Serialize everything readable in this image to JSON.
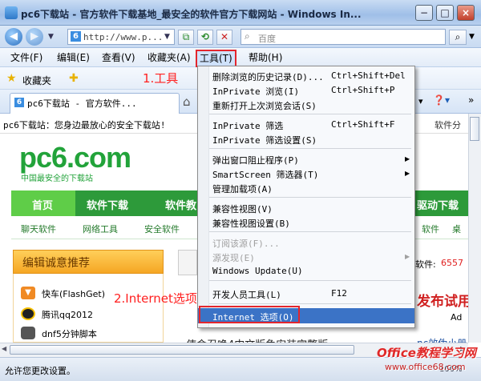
{
  "window": {
    "title": "pc6下载站 - 官方软件下载基地_最安全的软件官方下载网站 - Windows In...",
    "minimize": "−",
    "maximize": "□",
    "close": "×"
  },
  "address_bar": {
    "back": "◀",
    "forward": "▶",
    "url": "http://www.p...",
    "search_placeholder": "百度"
  },
  "menu_bar": {
    "items": [
      "文件(F)",
      "编辑(E)",
      "查看(V)",
      "收藏夹(A)",
      "工具(T)",
      "帮助(H)"
    ]
  },
  "favorites_bar": {
    "label": "收藏夹"
  },
  "tab": {
    "title": "pc6下载站 - 官方软件..."
  },
  "page": {
    "notice": "pc6下载站：您身边最放心的安全下载站!",
    "notice_right": "软件分",
    "logo_main": "pc6.com",
    "logo_sub": "中国最安全的下载站",
    "nav_tabs": [
      "首页",
      "软件下载",
      "软件教"
    ],
    "nav_right": "驱动下载",
    "sub_nav": [
      "聊天软件",
      "网络工具",
      "安全软件"
    ],
    "sub_nav_right": [
      "软件",
      "桌"
    ],
    "recommend_title": "编辑诚意推荐",
    "recommend_items": [
      "快车(FlashGet)",
      "腾讯qq2012",
      "dnf5分钟脚本"
    ],
    "right_soft": "软件:",
    "right_count": "6557",
    "right_headline": "发布试用",
    "right_ad": "Ad",
    "bottom_text": "使命召唤4中文版免安装完整版",
    "bottom_right": "nc效伪小册",
    "zoom": "100%",
    "status": "允许您更改设置。"
  },
  "tools_menu": {
    "items": [
      {
        "label": "删除浏览的历史记录(D)...",
        "shortcut": "Ctrl+Shift+Del"
      },
      {
        "label": "InPrivate 浏览(I)",
        "shortcut": "Ctrl+Shift+P"
      },
      {
        "label": "重新打开上次浏览会话(S)",
        "shortcut": ""
      },
      {
        "label": "InPrivate 筛选",
        "shortcut": "Ctrl+Shift+F"
      },
      {
        "label": "InPrivate 筛选设置(S)",
        "shortcut": ""
      },
      {
        "label": "弹出窗口阻止程序(P)",
        "shortcut": ""
      },
      {
        "label": "SmartScreen 筛选器(T)",
        "shortcut": ""
      },
      {
        "label": "管理加载项(A)",
        "shortcut": ""
      },
      {
        "label": "兼容性视图(V)",
        "shortcut": ""
      },
      {
        "label": "兼容性视图设置(B)",
        "shortcut": ""
      },
      {
        "label": "订阅该源(F)...",
        "shortcut": ""
      },
      {
        "label": "源发现(E)",
        "shortcut": ""
      },
      {
        "label": "Windows Update(U)",
        "shortcut": ""
      },
      {
        "label": "开发人员工具(L)",
        "shortcut": "F12"
      },
      {
        "label": "Internet 选项(O)",
        "shortcut": ""
      }
    ]
  },
  "annotations": {
    "step1": "1.工具",
    "step2": "2.Internet选项"
  },
  "watermark": {
    "line1": "Office教程学习网",
    "line2": "www.office68.com"
  },
  "colors": {
    "accent": "#3b73c6",
    "nav_green": "#2d9a3a",
    "annotation_red": "#e3262d"
  }
}
